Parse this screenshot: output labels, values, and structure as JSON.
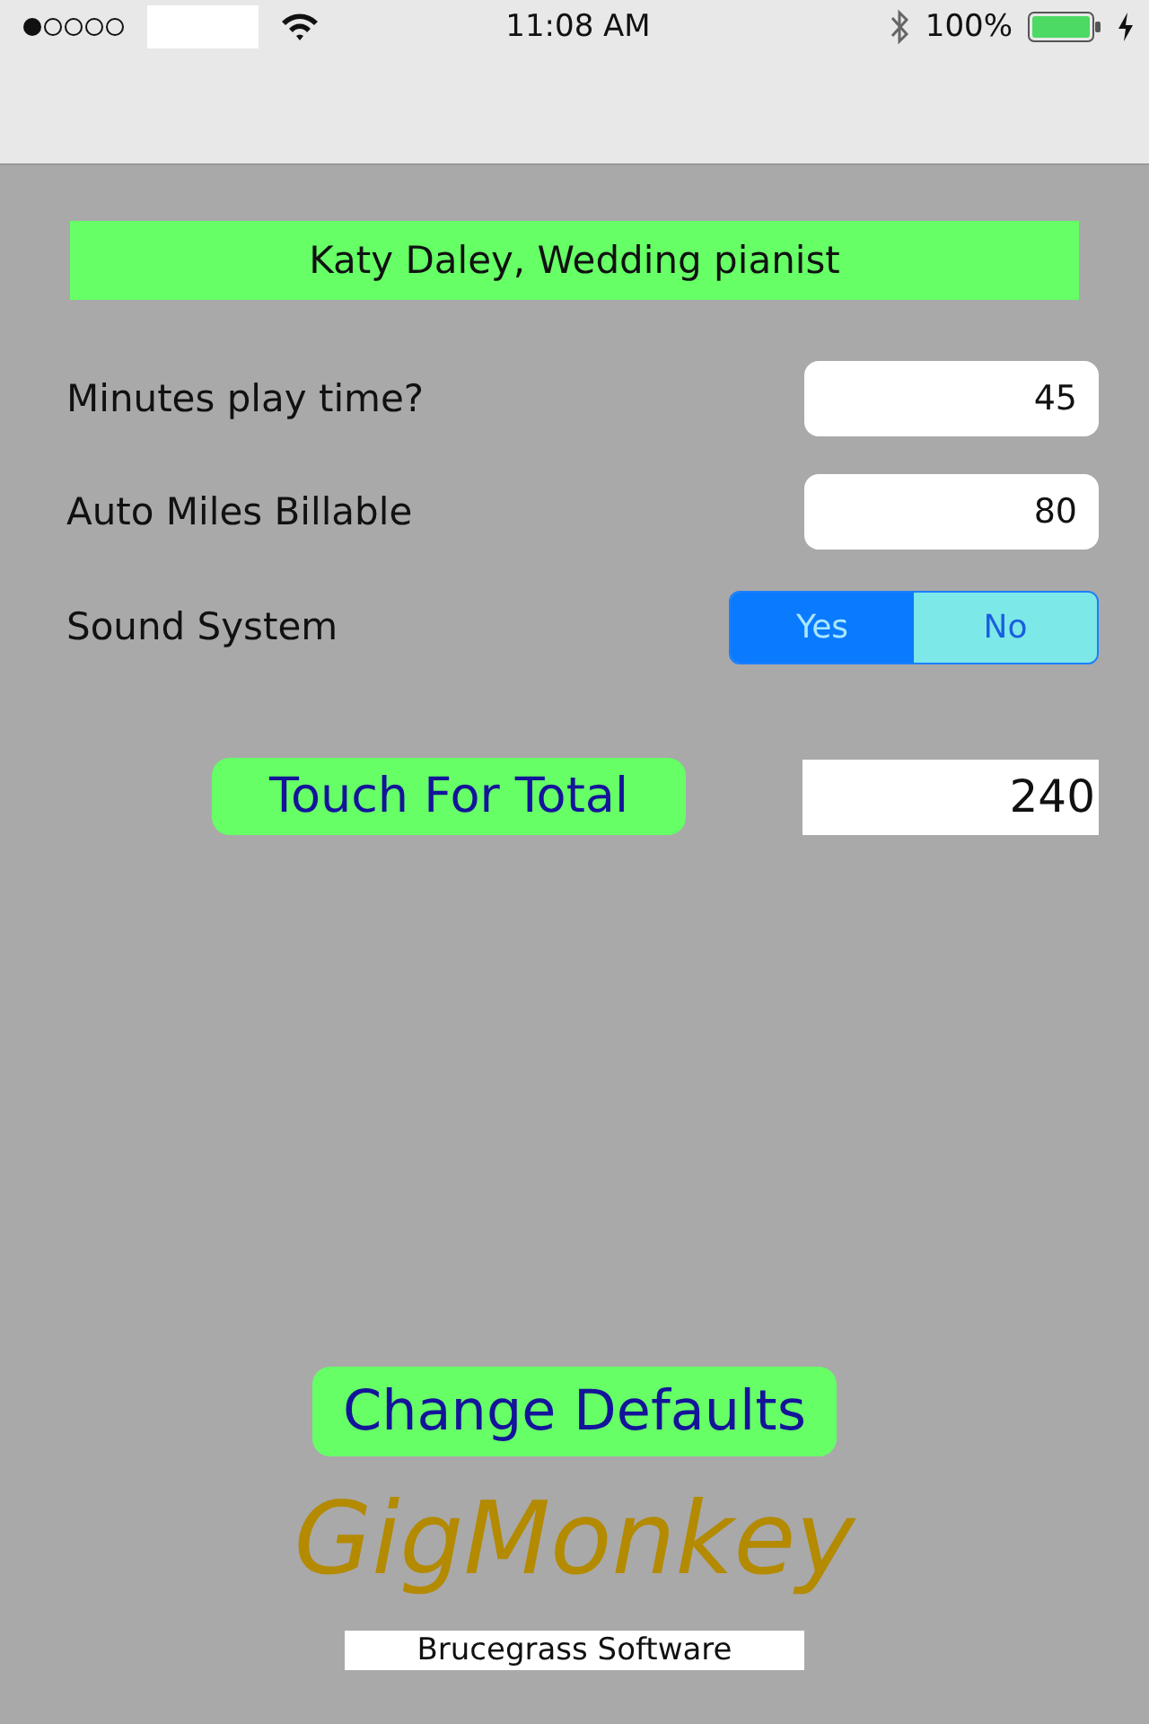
{
  "status_bar": {
    "time": "11:08 AM",
    "battery": "100%"
  },
  "title": "Katy Daley, Wedding pianist",
  "fields": [
    {
      "label": "Minutes play time?",
      "value": "45"
    },
    {
      "label": "Auto Miles Billable",
      "value": "80"
    }
  ],
  "sound_system": {
    "label": "Sound System",
    "options": [
      {
        "label": "Yes",
        "selected": true
      },
      {
        "label": "No",
        "selected": false
      }
    ]
  },
  "total_button": "Touch For Total",
  "total": "240",
  "defaults_button": "Change Defaults",
  "logo": "GigMonkey",
  "footer": "Brucegrass Software"
}
